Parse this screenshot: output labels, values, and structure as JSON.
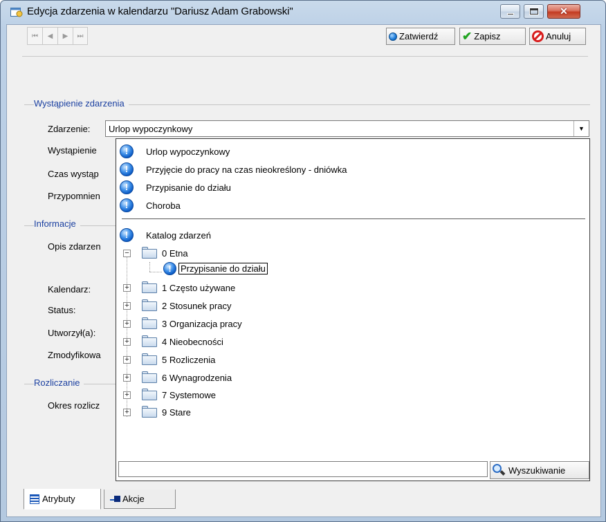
{
  "window": {
    "title": "Edycja zdarzenia w kalendarzu \"Dariusz Adam Grabowski\"",
    "min_glyph": "",
    "max_glyph": "",
    "close_glyph": "✕"
  },
  "toolbar": {
    "nav": [
      "⏮",
      "◀",
      "▶",
      "⏭"
    ],
    "confirm_label": "Zatwierdź",
    "save_label": "Zapisz",
    "cancel_label": "Anuluj"
  },
  "form": {
    "group_occurrence": "Wystąpienie zdarzenia",
    "group_info": "Informacje",
    "group_billing": "Rozliczanie",
    "labels": {
      "event": "Zdarzenie:",
      "occurrence": "Wystąpienie",
      "time": "Czas wystąp",
      "reminder": "Przypomnien",
      "description": "Opis zdarzen",
      "calendar": "Kalendarz:",
      "status": "Status:",
      "created": "Utworzył(a):",
      "modified": "Zmodyfikowa",
      "period": "Okres rozlicz"
    },
    "event_value": "Urlop wypoczynkowy"
  },
  "dropdown": {
    "recent": [
      "Urlop wypoczynkowy",
      "Przyjęcie do pracy na czas nieokreślony - dniówka",
      "Przypisanie do działu",
      "Choroba"
    ],
    "catalog_label": "Katalog zdarzeń",
    "tree": [
      {
        "label": "0 Etna",
        "expanded": true,
        "children": [
          "Przypisanie do działu"
        ]
      },
      {
        "label": "1 Często używane"
      },
      {
        "label": "2 Stosunek pracy"
      },
      {
        "label": "3 Organizacja pracy"
      },
      {
        "label": "4 Nieobecności"
      },
      {
        "label": "5 Rozliczenia"
      },
      {
        "label": "6 Wynagrodzenia"
      },
      {
        "label": "7 Systemowe"
      },
      {
        "label": "9 Stare"
      }
    ],
    "search_value": "",
    "search_button": "Wyszukiwanie"
  },
  "tabs": {
    "attributes": "Atrybuty",
    "actions": "Akcje"
  },
  "colors": {
    "group_title": "#1a3fa0",
    "accent_blue": "#0a58c2"
  }
}
